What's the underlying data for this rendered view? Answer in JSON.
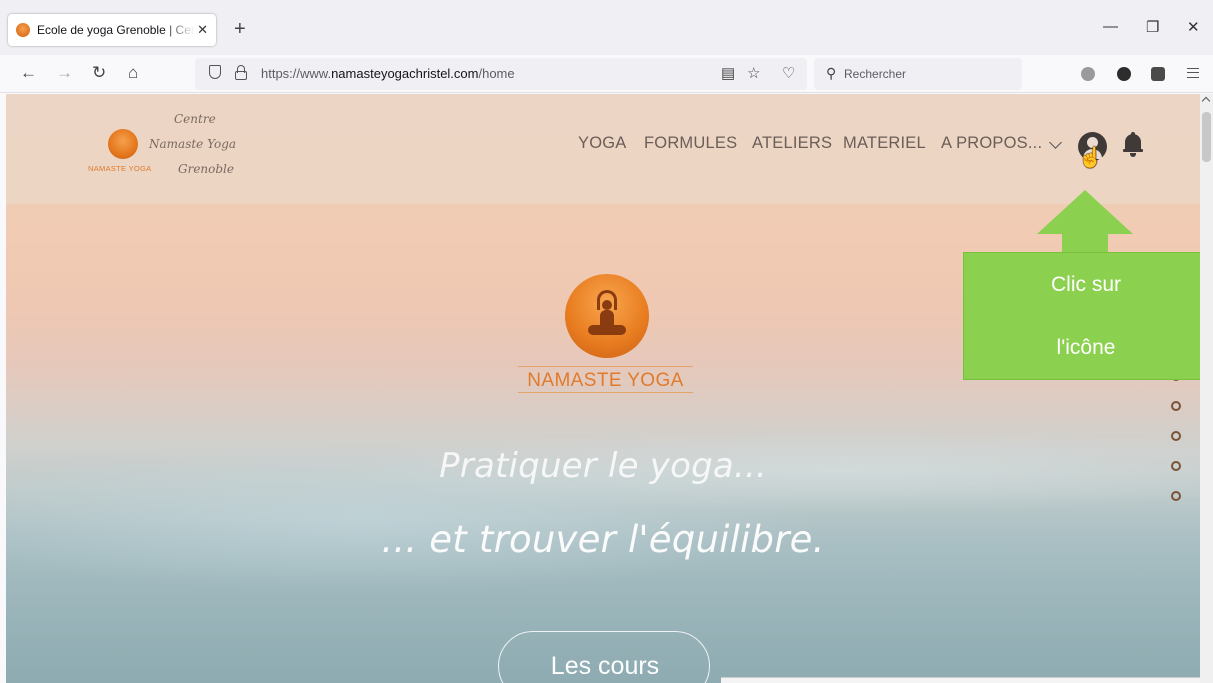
{
  "browser": {
    "tab_title": "Ecole de yoga Grenoble | Centre",
    "tab_close": "✕",
    "new_tab": "+",
    "window_controls": {
      "minimize": "—",
      "restore": "❐",
      "close": "✕"
    },
    "nav": {
      "back": "←",
      "forward": "→",
      "reload": "↻",
      "home": "⌂"
    },
    "url_prefix": "https://www.",
    "url_host": "namasteyogachristel.com",
    "url_path": "/home",
    "search_placeholder": "Rechercher",
    "icons": [
      "shield-icon",
      "lock-icon",
      "reader-view-icon",
      "bookmark-star-icon",
      "pocket-icon",
      "search-icon",
      "extension-icon",
      "menu-icon"
    ]
  },
  "site": {
    "logo_small_text": "NAMASTE YOGA",
    "name_lines": [
      "Centre",
      "Namaste Yoga",
      "Grenoble"
    ],
    "menu": [
      "YOGA",
      "FORMULES",
      "ATELIERS",
      "MATERIEL",
      "A PROPOS..."
    ],
    "logo_big_text": "NAMASTE YOGA",
    "headline_1": "Pratiquer le yoga...",
    "headline_2": "... et trouver l'équilibre.",
    "cta_label": "Les cours",
    "slider_dots": 5
  },
  "annotation": {
    "line_1": "Clic sur",
    "line_2": "l'icône",
    "color": "#8bd14f"
  },
  "colors": {
    "brand_orange": "#e17b2c",
    "menu_text": "#6b5e58"
  }
}
